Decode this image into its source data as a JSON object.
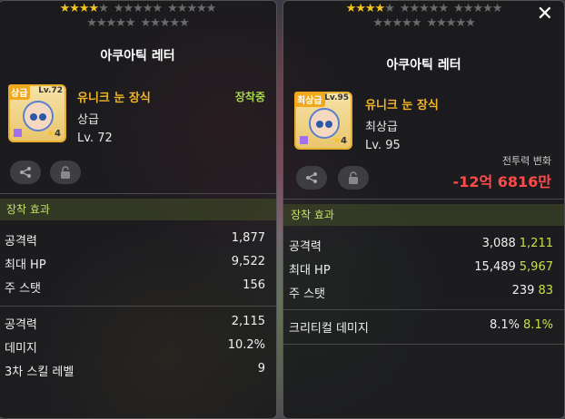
{
  "left": {
    "star_groups": [
      {
        "on": 4,
        "off": 1
      },
      {
        "on": 0,
        "off": 5
      },
      {
        "on": 0,
        "off": 5
      },
      {
        "on": 0,
        "off": 5
      },
      {
        "on": 0,
        "off": 5
      }
    ],
    "item_name": "아쿠아틱 레터",
    "grade_tag": "상급",
    "icon_level": "Lv.72",
    "icon_star": "4",
    "potential_title": "유니크 눈 장식",
    "grade": "상급",
    "level": "Lv. 72",
    "equipped": "장착중",
    "section_title": "장착 효과",
    "stats_a": [
      {
        "label": "공격력",
        "value": "1,877"
      },
      {
        "label": "최대 HP",
        "value": "9,522"
      },
      {
        "label": "주 스탯",
        "value": "156"
      }
    ],
    "stats_b": [
      {
        "label": "공격력",
        "value": "2,115"
      },
      {
        "label": "데미지",
        "value": "10.2%"
      },
      {
        "label": "3차 스킬 레벨",
        "value": "9"
      }
    ]
  },
  "right": {
    "star_groups": [
      {
        "on": 4,
        "off": 1
      },
      {
        "on": 0,
        "off": 5
      },
      {
        "on": 0,
        "off": 5
      },
      {
        "on": 0,
        "off": 5
      },
      {
        "on": 0,
        "off": 5
      }
    ],
    "item_name": "아쿠아틱 레터",
    "grade_tag": "최상급",
    "icon_level": "Lv.95",
    "icon_star": "4",
    "potential_title": "유니크 눈 장식",
    "grade": "최상급",
    "level": "Lv. 95",
    "power_label": "전투력 변화",
    "power_value": "-12억 6816만",
    "section_title": "장착 효과",
    "stats_a": [
      {
        "label": "공격력",
        "value": "3,088",
        "bonus": "1,211"
      },
      {
        "label": "최대 HP",
        "value": "15,489",
        "bonus": "5,967"
      },
      {
        "label": "주 스탯",
        "value": "239",
        "bonus": "83"
      }
    ],
    "stats_b": [
      {
        "label": "크리티컬 데미지",
        "value": "8.1%",
        "bonus": "8.1%"
      }
    ],
    "close_label": "✕"
  },
  "colors": {
    "accent_gold": "#f0b428",
    "equipped_green": "#a6d84a",
    "bonus_green": "#c8e04a",
    "power_red": "#ff4a4a"
  }
}
